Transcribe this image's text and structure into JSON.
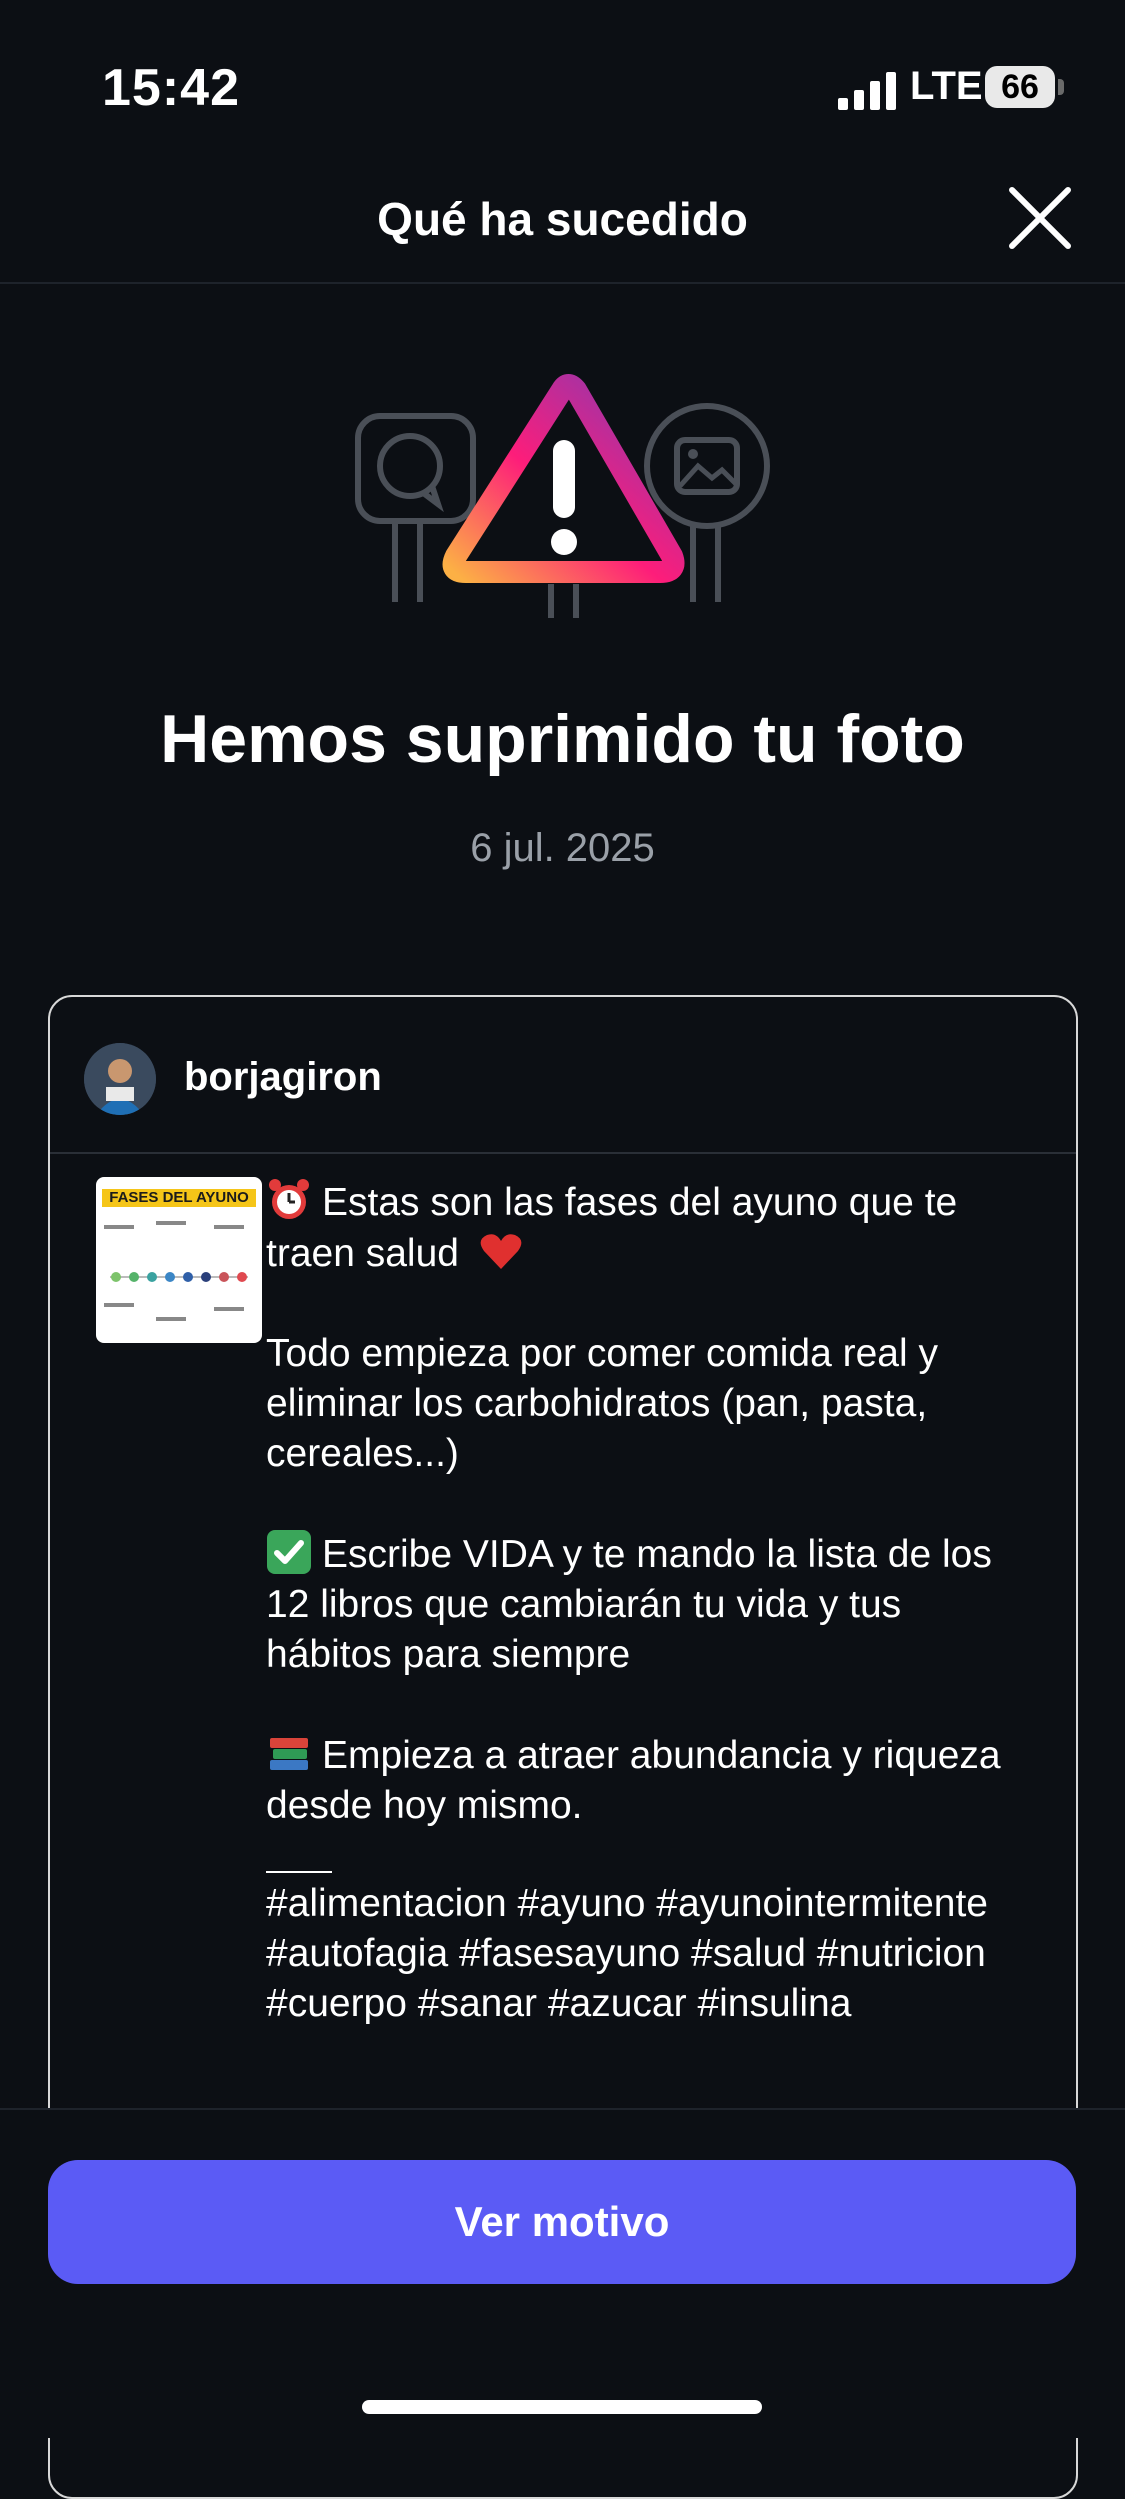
{
  "status_bar": {
    "time": "15:42",
    "network": "LTE",
    "battery": "66"
  },
  "header": {
    "title": "Qué ha sucedido"
  },
  "notice": {
    "title": "Hemos suprimido tu foto",
    "date": "6 jul. 2025"
  },
  "post": {
    "username": "borjagiron",
    "thumbnail_title": "FASES DEL AYUNO",
    "caption": {
      "p1": "Estas son las fases del ayuno que te traen salud",
      "p2": "Todo empieza por comer comida real y eliminar los carbohidratos (pan, pasta, cereales...)",
      "p3": "Escribe VIDA y te mando la lista de los 12 libros que cambiarán tu vida y tus hábitos para siempre",
      "p4": "Empieza a atraer abundancia y riqueza desde hoy mismo.",
      "hashtags": "#alimentacion #ayuno #ayunointermitente #autofagia #fasesayuno #salud #nutricion #cuerpo #sanar #azucar #insulina"
    }
  },
  "actions": {
    "ver_motivo": "Ver motivo"
  },
  "colors": {
    "background": "#0c0f14",
    "button": "#5b5bf5",
    "secondary_text": "#9aa0a8"
  },
  "icons": [
    "signal-icon",
    "battery-icon",
    "close-icon",
    "warning-illustration",
    "alarm-clock-emoji",
    "red-heart-emoji",
    "check-mark-emoji",
    "books-emoji"
  ]
}
